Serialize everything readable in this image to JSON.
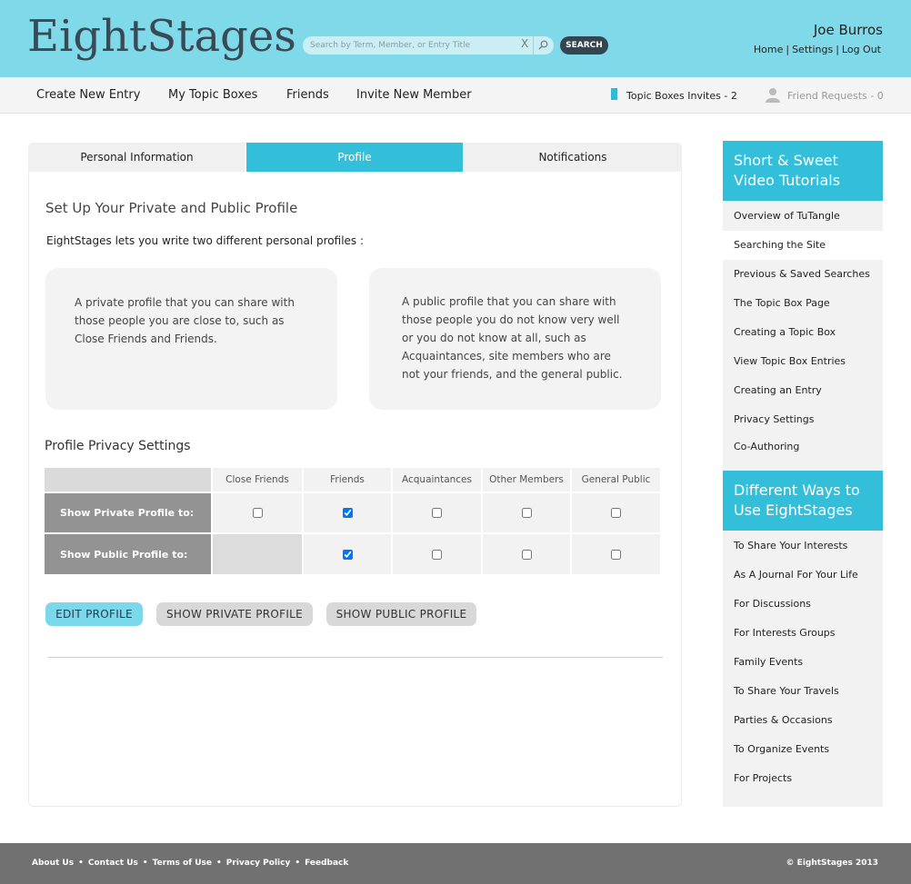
{
  "brand": {
    "logo": "EightStages"
  },
  "search": {
    "placeholder": "Search by Term, Member, or Entry Title",
    "clear_label": "X",
    "button_label": "SEARCH"
  },
  "user": {
    "name": "Joe Burros",
    "links": [
      "Home",
      "Settings",
      "Log Out"
    ],
    "separator": "|"
  },
  "nav": {
    "items": [
      "Create New Entry",
      "My Topic Boxes",
      "Friends",
      "Invite New Member"
    ],
    "topic_invites": "Topic Boxes Invites - 2",
    "friend_requests": "Friend Requests - 0"
  },
  "tabs": [
    {
      "label": "Personal Information",
      "active": false
    },
    {
      "label": "Profile",
      "active": true
    },
    {
      "label": "Notifications",
      "active": false
    }
  ],
  "main": {
    "title": "Set Up Your Private and Public Profile",
    "intro": "EightStages lets you write two different personal profiles :",
    "private_box": "A private profile that you can share with those people you are close to, such as Close Friends and Friends.",
    "public_box": "A public profile that you can share with those people you do not know very well or you do not know at all, such as Acquaintances, site members who are not your friends, and the general public.",
    "privacy_title": "Profile Privacy Settings"
  },
  "privacy_table": {
    "columns": [
      "Close Friends",
      "Friends",
      "Acquaintances",
      "Other Members",
      "General Public"
    ],
    "rows": [
      {
        "label": "Show Private Profile to:",
        "checks": [
          false,
          true,
          false,
          false,
          false
        ]
      },
      {
        "label": "Show Public Profile to:",
        "checks": [
          null,
          true,
          false,
          false,
          false
        ]
      }
    ]
  },
  "buttons": {
    "edit": "EDIT PROFILE",
    "show_private": "SHOW PRIVATE PROFILE",
    "show_public": "SHOW PUBLIC PROFILE"
  },
  "sidebar": {
    "tutorials_title": "Short & Sweet Video Tutorials",
    "tutorials": [
      "Overview of TuTangle",
      "Searching the Site",
      "Previous & Saved Searches",
      "The Topic Box Page",
      "Creating a Topic Box",
      "View Topic Box Entries",
      "Creating an Entry",
      "Privacy Settings",
      "Co-Authoring"
    ],
    "ways_title": "Different Ways to Use EightStages",
    "ways": [
      "To Share Your Interests",
      "As A Journal For Your Life",
      "For Discussions",
      "For Interests Groups",
      "Family Events",
      "To Share Your Travels",
      "Parties & Occasions",
      "To Organize Events",
      "For Projects"
    ]
  },
  "footer": {
    "links": [
      "About Us",
      "Contact Us",
      "Terms of Use",
      "Privacy Policy",
      "Feedback"
    ],
    "bullet": "•",
    "copyright": "© EightStages 2013"
  },
  "colors": {
    "header_bg": "#7fd9e8",
    "accent": "#33bfda",
    "footer_bg": "#717171",
    "row_head": "#939393"
  }
}
